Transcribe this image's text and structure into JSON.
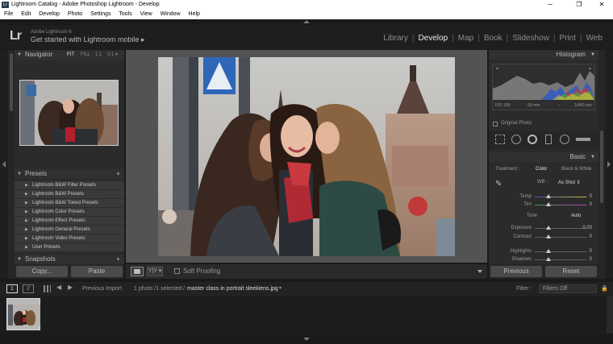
{
  "window": {
    "title": "Lightroom Catalog - Adobe Photoshop Lightroom - Develop",
    "app_icon": "Lr",
    "minimize": "─",
    "maximize": "❐",
    "close": "✕"
  },
  "menu": [
    "File",
    "Edit",
    "Develop",
    "Photo",
    "Settings",
    "Tools",
    "View",
    "Window",
    "Help"
  ],
  "identity": {
    "logo": "Lr",
    "small": "Adobe Lightroom 6",
    "big": "Get started with Lightroom mobile ▸"
  },
  "modules": [
    "Library",
    "Develop",
    "Map",
    "Book",
    "Slideshow",
    "Print",
    "Web"
  ],
  "active_module": "Develop",
  "navigator": {
    "title": "Navigator",
    "zoom_options": [
      "FIT",
      "FILL",
      "1:1",
      "3:1 ▾"
    ]
  },
  "presets": {
    "title": "Presets",
    "add": "+",
    "items": [
      "Lightroom B&W Filter Presets",
      "Lightroom B&W Presets",
      "Lightroom B&W Toned Presets",
      "Lightroom Color Presets",
      "Lightroom Effect Presets",
      "Lightroom General Presets",
      "Lightroom Video Presets",
      "User Presets"
    ]
  },
  "snapshots": {
    "title": "Snapshots",
    "add": "+"
  },
  "left_buttons": {
    "copy": "Copy...",
    "paste": "Paste"
  },
  "histogram": {
    "title": "Histogram",
    "iso": "ISO 100",
    "focal": "50 mm",
    "aperture": "--",
    "shutter": "1/400 sec",
    "original_photo": "Original Photo"
  },
  "basic": {
    "title": "Basic",
    "treatment_label": "Treatment :",
    "treatment_color": "Color",
    "treatment_bw": "Black & White",
    "wb_label": "WB :",
    "wb_value": "As Shot ⇕",
    "temp": {
      "label": "Temp",
      "value": "0"
    },
    "tint": {
      "label": "Tint",
      "value": "0"
    },
    "tone_label": "Tone",
    "auto": "Auto",
    "exposure": {
      "label": "Exposure",
      "value": "0.00"
    },
    "contrast": {
      "label": "Contrast",
      "value": "0"
    },
    "highlights": {
      "label": "Highlights",
      "value": "0"
    },
    "shadows": {
      "label": "Shadows",
      "value": "0"
    }
  },
  "right_buttons": {
    "previous": "Previous",
    "reset": "Reset"
  },
  "toolbar": {
    "soft_proofing": "Soft Proofing",
    "yy": "Y|Y ▾"
  },
  "filmstrip_bar": {
    "page1": "1",
    "page2": "2",
    "source": "Previous Import",
    "info": "1 photo /1 selected /",
    "filename": "master class in portrait sleekiens.jpg",
    "filter_label": "Filter :",
    "filter_value": "Filters Off"
  },
  "colors": {
    "accent": "#e8e8e8",
    "panel": "#2b2b2b",
    "background": "#1a1a1a"
  }
}
